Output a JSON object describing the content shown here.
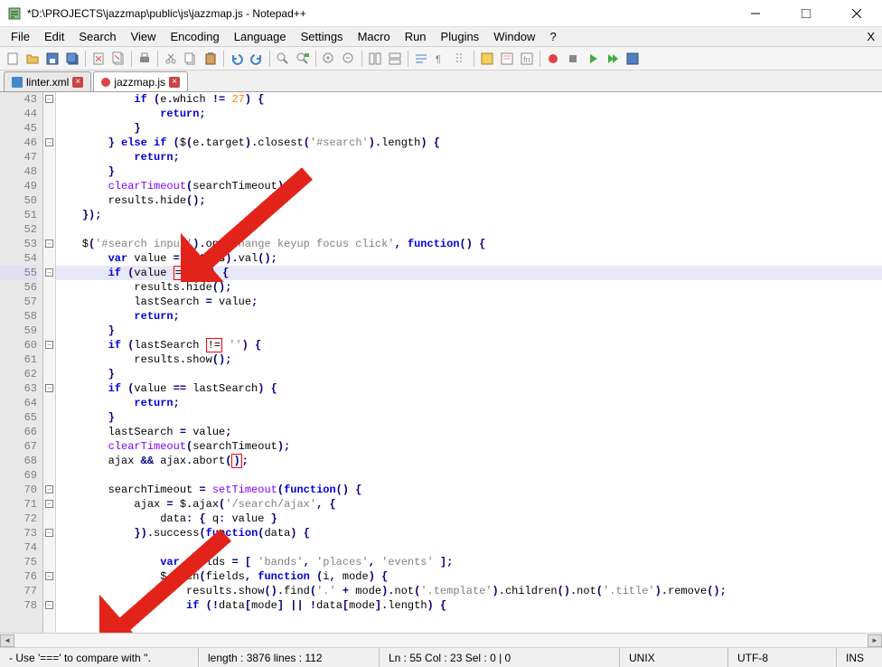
{
  "window": {
    "title": "*D:\\PROJECTS\\jazzmap\\public\\js\\jazzmap.js - Notepad++"
  },
  "menu": {
    "items": [
      "File",
      "Edit",
      "Search",
      "View",
      "Encoding",
      "Language",
      "Settings",
      "Macro",
      "Run",
      "Plugins",
      "Window",
      "?"
    ],
    "close": "X"
  },
  "tabs": [
    {
      "label": "linter.xml",
      "active": false
    },
    {
      "label": "jazzmap.js",
      "active": true
    }
  ],
  "gutter_start": 43,
  "code_lines": [
    {
      "n": 43,
      "html": "            <span class='kw'>if</span> <span class='op'>(</span>e<span class='op'>.</span>which <span class='op'>!=</span> <span class='num'>27</span><span class='op'>)</span> <span class='op'>{</span>",
      "fold": "-"
    },
    {
      "n": 44,
      "html": "                <span class='kw'>return</span><span class='op'>;</span>"
    },
    {
      "n": 45,
      "html": "            <span class='op'>}</span>"
    },
    {
      "n": 46,
      "html": "        <span class='op'>}</span> <span class='kw'>else</span> <span class='kw'>if</span> <span class='op'>(</span>$<span class='op'>(</span>e<span class='op'>.</span>target<span class='op'>).</span>closest<span class='op'>(</span><span class='str'>'#search'</span><span class='op'>).</span>length<span class='op'>)</span> <span class='op'>{</span>",
      "fold": "-"
    },
    {
      "n": 47,
      "html": "            <span class='kw'>return</span><span class='op'>;</span>"
    },
    {
      "n": 48,
      "html": "        <span class='op'>}</span>"
    },
    {
      "n": 49,
      "html": "        <span class='builtin'>clearTimeout</span><span class='op'>(</span>searchTimeout<span class='op'>);</span>"
    },
    {
      "n": 50,
      "html": "        results<span class='op'>.</span>hide<span class='op'>();</span>"
    },
    {
      "n": 51,
      "html": "    <span class='op'>});</span>"
    },
    {
      "n": 52,
      "html": ""
    },
    {
      "n": 53,
      "html": "    $<span class='op'>(</span><span class='str'>'#search input'</span><span class='op'>).</span>on<span class='op'>(</span><span class='str'>'change keyup focus click'</span><span class='op'>,</span> <span class='kw'>function</span><span class='op'>()</span> <span class='op'>{</span>",
      "fold": "-"
    },
    {
      "n": 54,
      "html": "        <span class='kw'>var</span> value <span class='op'>=</span> $<span class='op'>(</span><span class='this'>this</span><span class='op'>).</span>val<span class='op'>();</span>"
    },
    {
      "n": 55,
      "html": "        <span class='kw'>if</span> <span class='op'>(</span>value <span class='err-box'>==</span> <span class='str'>''</span><span class='op'>)</span> <span class='op'>{</span>",
      "current": true,
      "fold": "-",
      "changed": true
    },
    {
      "n": 56,
      "html": "            results<span class='op'>.</span>hide<span class='op'>();</span>"
    },
    {
      "n": 57,
      "html": "            lastSearch <span class='op'>=</span> value<span class='op'>;</span>"
    },
    {
      "n": 58,
      "html": "            <span class='kw'>return</span><span class='op'>;</span>"
    },
    {
      "n": 59,
      "html": "        <span class='op'>}</span>"
    },
    {
      "n": 60,
      "html": "        <span class='kw'>if</span> <span class='op'>(</span>lastSearch <span class='err-box'>!=</span> <span class='str'>''</span><span class='op'>)</span> <span class='op'>{</span>",
      "fold": "-"
    },
    {
      "n": 61,
      "html": "            results<span class='op'>.</span>show<span class='op'>();</span>"
    },
    {
      "n": 62,
      "html": "        <span class='op'>}</span>"
    },
    {
      "n": 63,
      "html": "        <span class='kw'>if</span> <span class='op'>(</span>value <span class='op'>==</span> lastSearch<span class='op'>)</span> <span class='op'>{</span>",
      "fold": "-"
    },
    {
      "n": 64,
      "html": "            <span class='kw'>return</span><span class='op'>;</span>"
    },
    {
      "n": 65,
      "html": "        <span class='op'>}</span>"
    },
    {
      "n": 66,
      "html": "        lastSearch <span class='op'>=</span> value<span class='op'>;</span>"
    },
    {
      "n": 67,
      "html": "        <span class='builtin'>clearTimeout</span><span class='op'>(</span>searchTimeout<span class='op'>);</span>"
    },
    {
      "n": 68,
      "html": "        ajax <span class='op'>&amp;&amp;</span> ajax<span class='op'>.</span>abort<span class='op'>(<span class='err-box'>)</span>;</span>"
    },
    {
      "n": 69,
      "html": ""
    },
    {
      "n": 70,
      "html": "        searchTimeout <span class='op'>=</span> <span class='builtin'>setTimeout</span><span class='op'>(</span><span class='kw'>function</span><span class='op'>()</span> <span class='op'>{</span>",
      "fold": "-"
    },
    {
      "n": 71,
      "html": "            ajax <span class='op'>=</span> $<span class='op'>.</span>ajax<span class='op'>(</span><span class='str'>'/search/ajax'</span><span class='op'>,</span> <span class='op'>{</span>",
      "fold": "-"
    },
    {
      "n": 72,
      "html": "                data<span class='op'>:</span> <span class='op'>{</span> q<span class='op'>:</span> value <span class='op'>}</span>"
    },
    {
      "n": 73,
      "html": "            <span class='op'>}).</span>success<span class='op'>(</span><span class='kw'>function</span><span class='op'>(</span>data<span class='op'>)</span> <span class='op'>{</span>",
      "fold": "-"
    },
    {
      "n": 74,
      "html": ""
    },
    {
      "n": 75,
      "html": "                <span class='kw'>var</span> fields <span class='op'>=</span> <span class='op'>[</span> <span class='str'>'bands'</span><span class='op'>,</span> <span class='str'>'places'</span><span class='op'>,</span> <span class='str'>'events'</span> <span class='op'>];</span>"
    },
    {
      "n": 76,
      "html": "                $<span class='op'>.</span>each<span class='op'>(</span>fields<span class='op'>,</span> <span class='kw'>function</span> <span class='op'>(</span>i<span class='op'>,</span> mode<span class='op'>)</span> <span class='op'>{</span>",
      "fold": "-"
    },
    {
      "n": 77,
      "html": "                    results<span class='op'>.</span>show<span class='op'>().</span>find<span class='op'>(</span><span class='str'>'.'</span> <span class='op'>+</span> mode<span class='op'>).</span>not<span class='op'>(</span><span class='str'>'.template'</span><span class='op'>).</span>children<span class='op'>().</span>not<span class='op'>(</span><span class='str'>'.title'</span><span class='op'>).</span>remove<span class='op'>();</span>"
    },
    {
      "n": 78,
      "html": "                    <span class='kw'>if</span> <span class='op'>(!</span>data<span class='op'>[</span>mode<span class='op'>]</span> <span class='op'>||</span> <span class='op'>!</span>data<span class='op'>[</span>mode<span class='op'>].</span>length<span class='op'>)</span> <span class='op'>{</span>",
      "fold": "-"
    }
  ],
  "status": {
    "hint": "- Use '===' to compare with ''.",
    "length": "length : 3876    lines : 112",
    "pos": "Ln : 55    Col : 23    Sel : 0 | 0",
    "eol": "UNIX",
    "enc": "UTF-8",
    "ins": "INS"
  }
}
